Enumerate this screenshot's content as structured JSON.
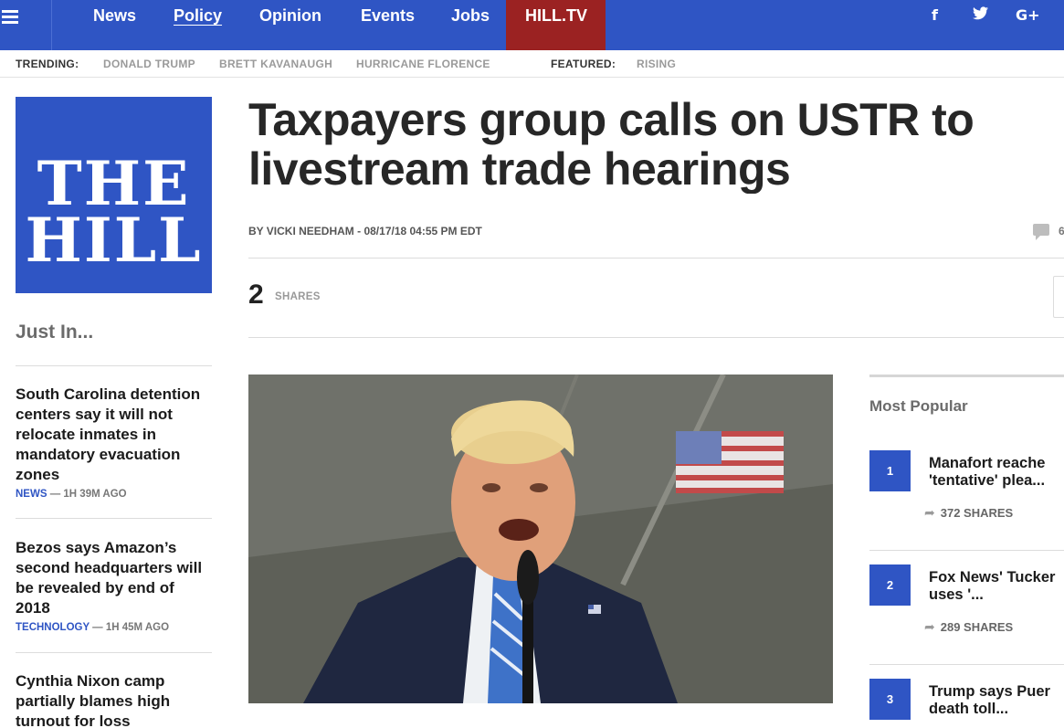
{
  "nav": {
    "links": [
      "News",
      "Policy",
      "Opinion",
      "Events",
      "Jobs"
    ],
    "active": "Policy",
    "hilltv": "HILL.TV",
    "social": [
      "f",
      "t",
      "G+"
    ]
  },
  "trending": {
    "label": "TRENDING:",
    "items": [
      "DONALD TRUMP",
      "BRETT KAVANAUGH",
      "HURRICANE FLORENCE"
    ],
    "featured_label": "FEATURED:",
    "featured_items": [
      "RISING"
    ]
  },
  "logo": {
    "line1": "THE",
    "line2": "HILL"
  },
  "just_in": {
    "title": "Just In...",
    "stories": [
      {
        "title": "South Carolina detention centers say it will not relocate inmates in mandatory evacuation zones",
        "category": "NEWS",
        "time": "— 1H 39M AGO"
      },
      {
        "title": "Bezos says Amazon’s second headquarters will be revealed by end of 2018",
        "category": "TECHNOLOGY",
        "time": "— 1H 45M AGO"
      },
      {
        "title": "Cynthia Nixon camp partially blames high turnout for loss",
        "category": "",
        "time": ""
      }
    ]
  },
  "article": {
    "headline_line1": "Taxpayers group calls on USTR to",
    "headline_line2": "livestream trade hearings",
    "byline": "BY VICKI NEEDHAM - 08/17/18 04:55 PM EDT",
    "comment_count": "6",
    "shares": "2",
    "shares_label": "SHARES"
  },
  "most_popular": {
    "title": "Most Popular",
    "items": [
      {
        "rank": "1",
        "line1": "Manafort reache",
        "line2": "'tentative' plea...",
        "shares": "372 SHARES"
      },
      {
        "rank": "2",
        "line1": "Fox News' Tucker",
        "line2": "uses '...",
        "shares": "289 SHARES"
      },
      {
        "rank": "3",
        "line1": "Trump says Puer",
        "line2": "death toll...",
        "shares": ""
      }
    ]
  },
  "colors": {
    "brand_blue": "#2f55c4",
    "hilltv_red": "#9b2222"
  }
}
